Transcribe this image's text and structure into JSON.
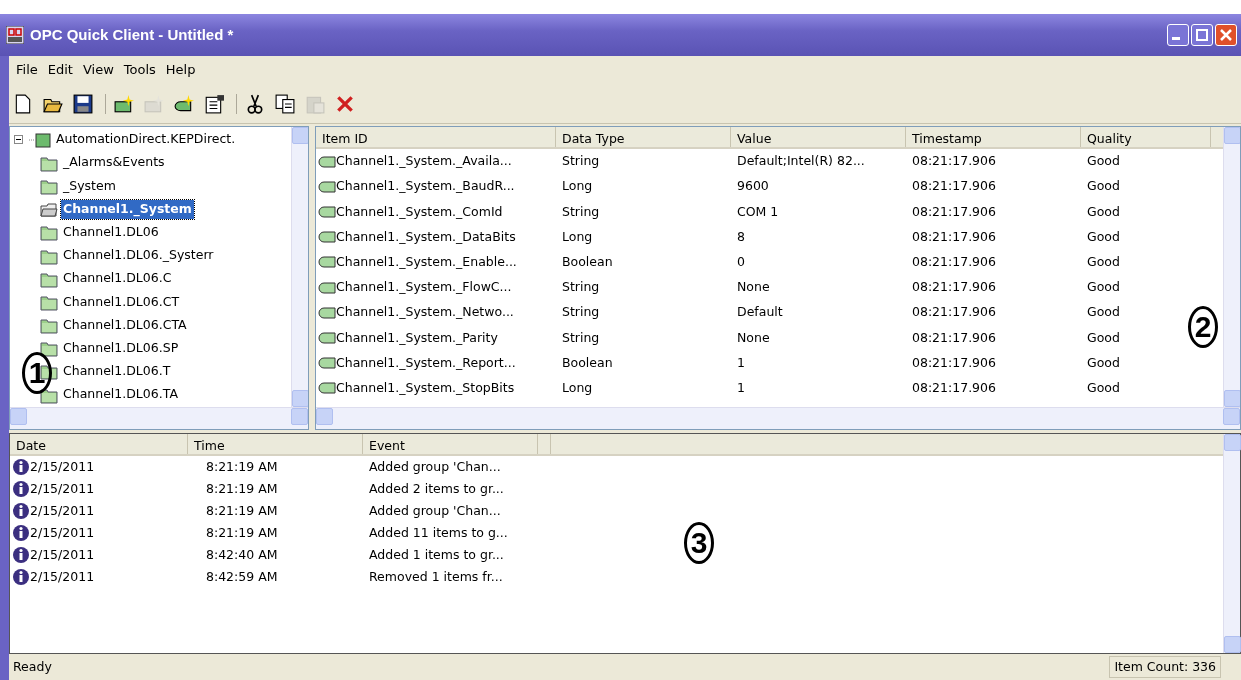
{
  "window": {
    "title": "OPC Quick Client - Untitled *"
  },
  "menu": [
    "File",
    "Edit",
    "View",
    "Tools",
    "Help"
  ],
  "toolbar": [
    {
      "kind": "new",
      "disabled": false
    },
    {
      "kind": "open",
      "disabled": false
    },
    {
      "kind": "save",
      "disabled": false
    },
    {
      "kind": "separator"
    },
    {
      "kind": "new-server",
      "disabled": false
    },
    {
      "kind": "new-group",
      "disabled": true
    },
    {
      "kind": "new-item",
      "disabled": false
    },
    {
      "kind": "properties",
      "disabled": false
    },
    {
      "kind": "separator"
    },
    {
      "kind": "cut",
      "disabled": false
    },
    {
      "kind": "copy",
      "disabled": false
    },
    {
      "kind": "paste",
      "disabled": true
    },
    {
      "kind": "delete",
      "disabled": false
    }
  ],
  "tree": [
    {
      "label": "AutomationDirect.KEPDirect.",
      "kind": "server",
      "expanded": true,
      "selected": false,
      "children": [
        {
          "label": "_Alarms&Events",
          "kind": "group",
          "selected": false
        },
        {
          "label": "_System",
          "kind": "group",
          "selected": false
        },
        {
          "label": "Channel1._System",
          "kind": "group",
          "selected": true
        },
        {
          "label": "Channel1.DL06",
          "kind": "group",
          "selected": false
        },
        {
          "label": "Channel1.DL06._Systerr",
          "kind": "group",
          "selected": false
        },
        {
          "label": "Channel1.DL06.C",
          "kind": "group",
          "selected": false
        },
        {
          "label": "Channel1.DL06.CT",
          "kind": "group",
          "selected": false
        },
        {
          "label": "Channel1.DL06.CTA",
          "kind": "group",
          "selected": false
        },
        {
          "label": "Channel1.DL06.SP",
          "kind": "group",
          "selected": false
        },
        {
          "label": "Channel1.DL06.T",
          "kind": "group",
          "selected": false
        },
        {
          "label": "Channel1.DL06.TA",
          "kind": "group",
          "selected": false
        }
      ]
    }
  ],
  "items": {
    "columns": [
      "Item ID",
      "Data Type",
      "Value",
      "Timestamp",
      "Quality"
    ],
    "rows": [
      [
        "Channel1._System._Availa...",
        "String",
        "Default;Intel(R) 82...",
        "08:21:17.906",
        "Good"
      ],
      [
        "Channel1._System._BaudR...",
        "Long",
        "9600",
        "08:21:17.906",
        "Good"
      ],
      [
        "Channel1._System._ComId",
        "String",
        "COM 1",
        "08:21:17.906",
        "Good"
      ],
      [
        "Channel1._System._DataBits",
        "Long",
        "8",
        "08:21:17.906",
        "Good"
      ],
      [
        "Channel1._System._Enable...",
        "Boolean",
        "0",
        "08:21:17.906",
        "Good"
      ],
      [
        "Channel1._System._FlowC...",
        "String",
        "None",
        "08:21:17.906",
        "Good"
      ],
      [
        "Channel1._System._Netwo...",
        "String",
        "Default",
        "08:21:17.906",
        "Good"
      ],
      [
        "Channel1._System._Parity",
        "String",
        "None",
        "08:21:17.906",
        "Good"
      ],
      [
        "Channel1._System._Report...",
        "Boolean",
        "1",
        "08:21:17.906",
        "Good"
      ],
      [
        "Channel1._System._StopBits",
        "Long",
        "1",
        "08:21:17.906",
        "Good"
      ]
    ]
  },
  "log": {
    "columns": [
      "Date",
      "Time",
      "Event"
    ],
    "rows": [
      [
        "2/15/2011",
        "8:21:19 AM",
        "Added group 'Chan..."
      ],
      [
        "2/15/2011",
        "8:21:19 AM",
        "Added 2 items to gr..."
      ],
      [
        "2/15/2011",
        "8:21:19 AM",
        "Added group 'Chan..."
      ],
      [
        "2/15/2011",
        "8:21:19 AM",
        "Added 11 items to g..."
      ],
      [
        "2/15/2011",
        "8:42:40 AM",
        "Added 1 items to gr..."
      ],
      [
        "2/15/2011",
        "8:42:59 AM",
        "Removed 1 items fr..."
      ]
    ]
  },
  "status_bar": {
    "text": "Ready",
    "item_count": "Item Count: 336"
  },
  "annotations": [
    {
      "label": "1"
    },
    {
      "label": "2"
    },
    {
      "label": "3"
    }
  ]
}
